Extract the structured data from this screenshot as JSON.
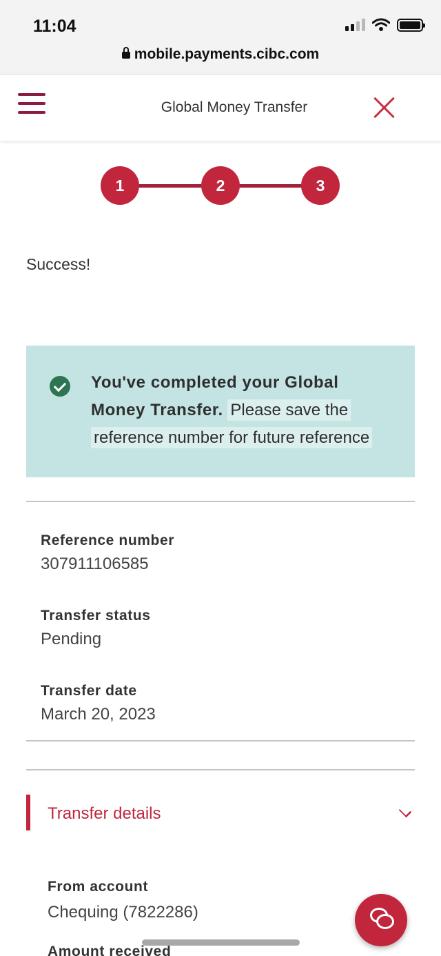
{
  "status_bar": {
    "time": "11:04"
  },
  "browser": {
    "url": "mobile.payments.cibc.com"
  },
  "header": {
    "title": "Global Money Transfer"
  },
  "stepper": {
    "steps": [
      "1",
      "2",
      "3"
    ],
    "current": 3
  },
  "page": {
    "heading": "Success!"
  },
  "banner": {
    "strong": "You've completed your Global Money Transfer.",
    "message_1": "Please save the",
    "message_2": "reference number for future reference"
  },
  "summary": {
    "reference_label": "Reference number",
    "reference_value": "307911106585",
    "status_label": "Transfer status",
    "status_value": "Pending",
    "date_label": "Transfer date",
    "date_value": "March 20, 2023"
  },
  "details": {
    "title": "Transfer details",
    "from_label": "From account",
    "from_value": "Chequing (7822286)",
    "amount_label": "Amount received"
  },
  "colors": {
    "brand": "#c1263d",
    "brand_dark": "#8b1d3e",
    "banner_bg": "#c4e3e3",
    "success": "#2d7552"
  },
  "icons": {
    "menu": "hamburger-icon",
    "close": "close-icon",
    "check": "check-circle-icon",
    "chevron": "chevron-down-icon",
    "chat": "chat-icon"
  }
}
